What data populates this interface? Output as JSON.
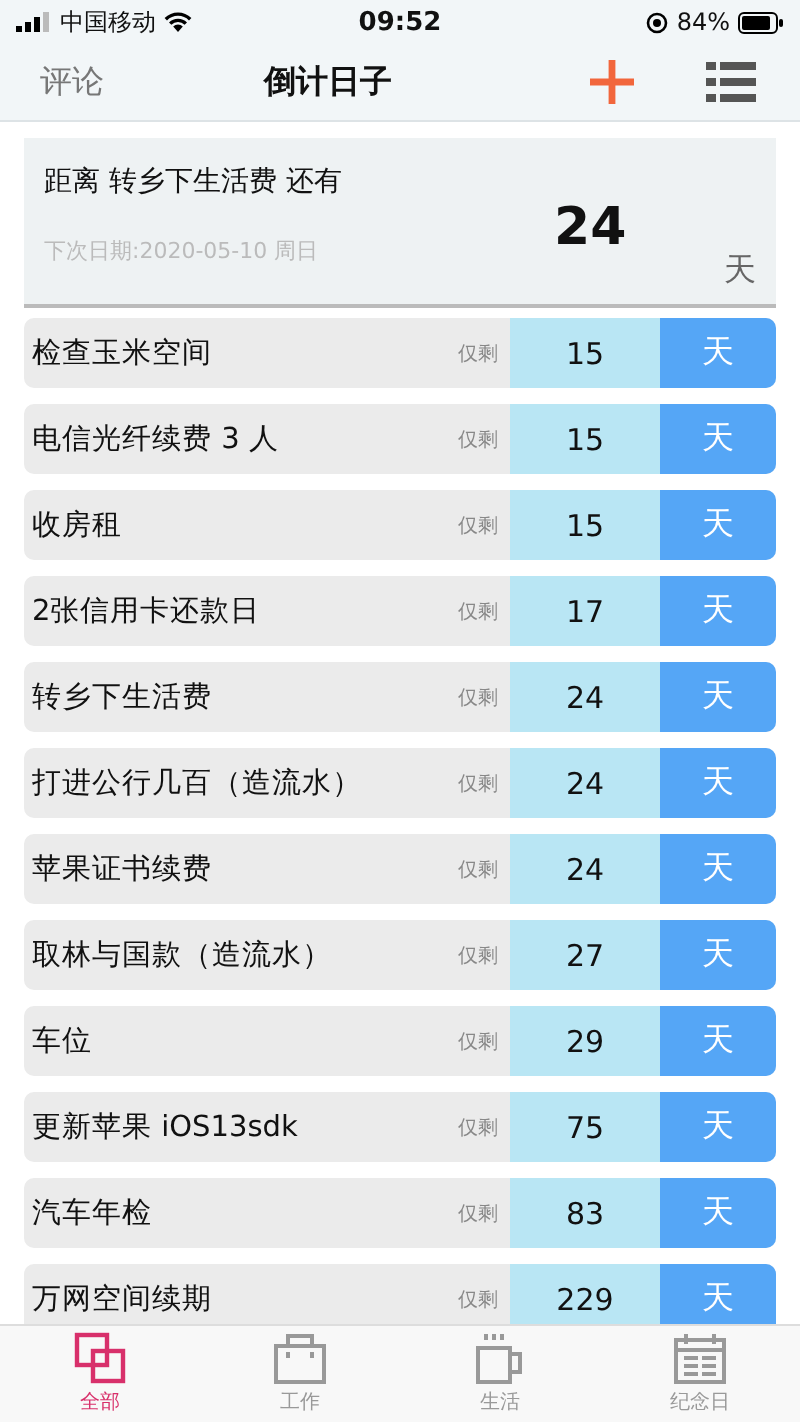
{
  "status_bar": {
    "carrier": "中国移动",
    "time": "09:52",
    "battery": "84%"
  },
  "nav": {
    "left": "评论",
    "title": "倒计日子"
  },
  "summary": {
    "sentence": "距离 转乡下生活费 还有",
    "next_date": "下次日期:2020-05-10 周日",
    "days": "24",
    "unit": "天"
  },
  "items": [
    {
      "name": "检查玉米空间",
      "remain": "仅剩",
      "days": "15",
      "unit": "天"
    },
    {
      "name": "电信光纤续费 3 人",
      "remain": "仅剩",
      "days": "15",
      "unit": "天"
    },
    {
      "name": "收房租",
      "remain": "仅剩",
      "days": "15",
      "unit": "天"
    },
    {
      "name": "2张信用卡还款日",
      "remain": "仅剩",
      "days": "17",
      "unit": "天"
    },
    {
      "name": "转乡下生活费",
      "remain": "仅剩",
      "days": "24",
      "unit": "天"
    },
    {
      "name": "打进公行几百（造流水）",
      "remain": "仅剩",
      "days": "24",
      "unit": "天"
    },
    {
      "name": "苹果证书续费",
      "remain": "仅剩",
      "days": "24",
      "unit": "天"
    },
    {
      "name": "取林与国款（造流水）",
      "remain": "仅剩",
      "days": "27",
      "unit": "天"
    },
    {
      "name": "车位",
      "remain": "仅剩",
      "days": "29",
      "unit": "天"
    },
    {
      "name": "更新苹果 iOS13sdk",
      "remain": "仅剩",
      "days": "75",
      "unit": "天"
    },
    {
      "name": "汽车年检",
      "remain": "仅剩",
      "days": "83",
      "unit": "天"
    },
    {
      "name": "万网空间续期",
      "remain": "仅剩",
      "days": "229",
      "unit": "天"
    }
  ],
  "tabs": [
    {
      "label": "全部",
      "kind": "all",
      "selected": true
    },
    {
      "label": "工作",
      "kind": "work",
      "selected": false
    },
    {
      "label": "生活",
      "kind": "life",
      "selected": false
    },
    {
      "label": "纪念日",
      "kind": "anniversary",
      "selected": false
    }
  ]
}
